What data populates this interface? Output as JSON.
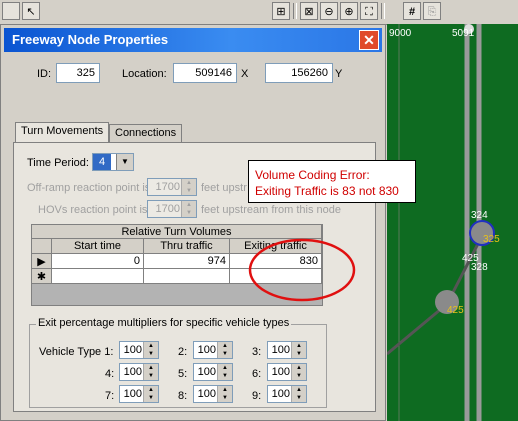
{
  "toolbar": {
    "pointer_glyph": "↖",
    "tools": [
      "zoom-node-icon",
      "zoom-out-icon",
      "zoom-in-icon",
      "fit-icon",
      "grid-icon",
      "copy-icon"
    ]
  },
  "map": {
    "labels": [
      {
        "text": "9000"
      },
      {
        "text": "5091"
      },
      {
        "text": "324"
      },
      {
        "text": "325"
      },
      {
        "text": "425"
      },
      {
        "text": "328"
      },
      {
        "text": "425"
      }
    ]
  },
  "dialog": {
    "title": "Freeway Node Properties",
    "close": "✕",
    "id_label": "ID:",
    "id_value": "325",
    "location_label": "Location:",
    "location_x": "509146",
    "x_label": "X",
    "location_y": "156260",
    "y_label": "Y",
    "tabs": [
      "Turn Movements",
      "Connections"
    ],
    "time_period_label": "Time Period:",
    "time_period_value": "4",
    "offramp_label": "Off-ramp reaction point is",
    "offramp_value": "1700",
    "offramp_suffix": "feet upstr",
    "hov_label": "HOVs reaction point is",
    "hov_value": "1700",
    "hov_suffix": "feet upstream from this node",
    "grid": {
      "title": "Relative Turn Volumes",
      "headers": [
        "Start time",
        "Thru traffic",
        "Exiting traffic"
      ],
      "rows": [
        {
          "marker": "▶",
          "cells": [
            "0",
            "974",
            "830"
          ]
        },
        {
          "marker": "✱",
          "cells": [
            "",
            "",
            ""
          ]
        }
      ]
    },
    "exit_group": {
      "title": "Exit percentage multipliers for specific vehicle types",
      "vehicle_label": "Vehicle Type 1:",
      "items": [
        {
          "label": "",
          "value": "100"
        },
        {
          "label": "2:",
          "value": "100"
        },
        {
          "label": "3:",
          "value": "100"
        },
        {
          "label": "4:",
          "value": "100"
        },
        {
          "label": "5:",
          "value": "100"
        },
        {
          "label": "6:",
          "value": "100"
        },
        {
          "label": "7:",
          "value": "100"
        },
        {
          "label": "8:",
          "value": "100"
        },
        {
          "label": "9:",
          "value": "100"
        }
      ]
    }
  },
  "annotation": {
    "line1": "Volume Coding Error:",
    "line2": "Exiting Traffic is 83 not 830",
    "color": "#d00000"
  }
}
